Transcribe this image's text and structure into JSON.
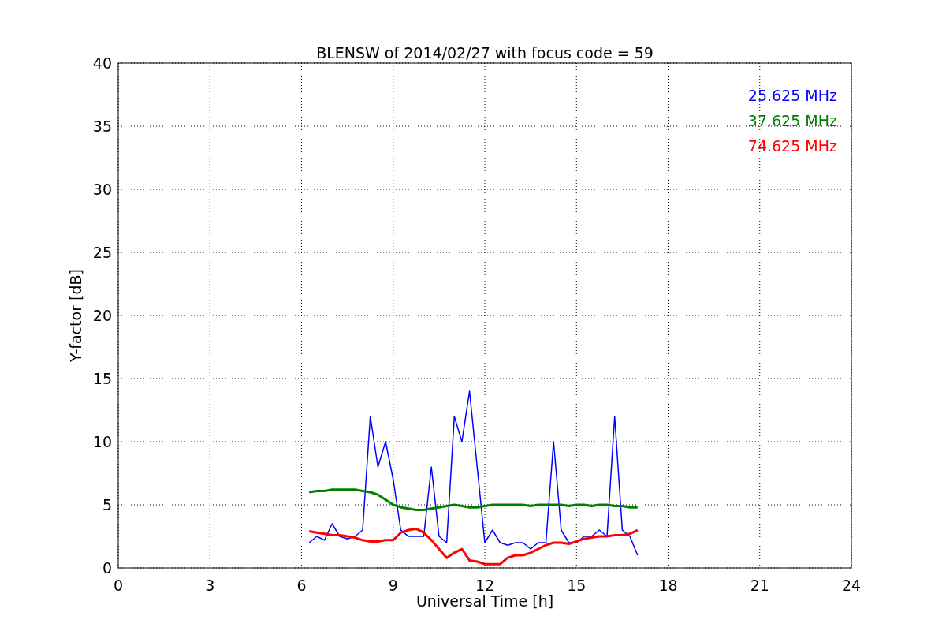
{
  "figure": {
    "chart_data": {
      "type": "line",
      "title": "BLENSW of 2014/02/27 with focus code = 59",
      "xlabel": "Universal Time [h]",
      "ylabel": "Y-factor [dB]",
      "x": [
        6.25,
        6.5,
        6.75,
        7,
        7.25,
        7.5,
        7.75,
        8,
        8.25,
        8.5,
        8.75,
        9,
        9.25,
        9.5,
        9.75,
        10,
        10.25,
        10.5,
        10.75,
        11,
        11.25,
        11.5,
        11.75,
        12,
        12.25,
        12.5,
        12.75,
        13,
        13.25,
        13.5,
        13.75,
        14,
        14.25,
        14.5,
        14.75,
        15,
        15.25,
        15.5,
        15.75,
        16,
        16.25,
        16.5,
        16.75,
        17
      ],
      "series": [
        {
          "name": "25.625 MHz",
          "color": "#0000ff",
          "values": [
            2,
            2.5,
            2.2,
            3.5,
            2.5,
            2.3,
            2.5,
            3,
            12,
            8,
            10,
            7,
            3,
            2.5,
            2.5,
            2.5,
            8,
            2.5,
            2,
            12,
            10,
            14,
            8,
            2,
            3,
            2,
            1.8,
            2,
            2,
            1.5,
            2,
            2,
            10,
            3,
            2,
            2,
            2.5,
            2.5,
            3,
            2.5,
            12,
            3,
            2.5,
            1
          ]
        },
        {
          "name": "37.625 MHz",
          "color": "#008000",
          "values": [
            6,
            6.1,
            6.1,
            6.2,
            6.2,
            6.2,
            6.2,
            6.1,
            6,
            5.8,
            5.4,
            5,
            4.8,
            4.7,
            4.6,
            4.6,
            4.7,
            4.8,
            4.9,
            5,
            4.9,
            4.8,
            4.8,
            4.9,
            5,
            5,
            5,
            5,
            5,
            4.9,
            5,
            5,
            5,
            5,
            4.9,
            5,
            5,
            4.9,
            5,
            5,
            4.9,
            4.9,
            4.8,
            4.8
          ]
        },
        {
          "name": "74.625 MHz",
          "color": "#ff0000",
          "values": [
            2.9,
            2.8,
            2.7,
            2.6,
            2.6,
            2.5,
            2.4,
            2.2,
            2.1,
            2.1,
            2.2,
            2.2,
            2.8,
            3,
            3.1,
            2.8,
            2.2,
            1.5,
            0.8,
            1.2,
            1.5,
            0.6,
            0.5,
            0.3,
            0.3,
            0.3,
            0.8,
            1,
            1,
            1.2,
            1.5,
            1.8,
            2,
            2,
            1.9,
            2.1,
            2.3,
            2.4,
            2.5,
            2.5,
            2.6,
            2.6,
            2.7,
            3
          ]
        }
      ],
      "grid": true,
      "xlim": [
        0,
        24
      ],
      "ylim": [
        0,
        40
      ],
      "xticks": [
        0,
        3,
        6,
        9,
        12,
        15,
        18,
        21,
        24
      ],
      "yticks": [
        0,
        5,
        10,
        15,
        20,
        25,
        30,
        35,
        40
      ]
    }
  }
}
